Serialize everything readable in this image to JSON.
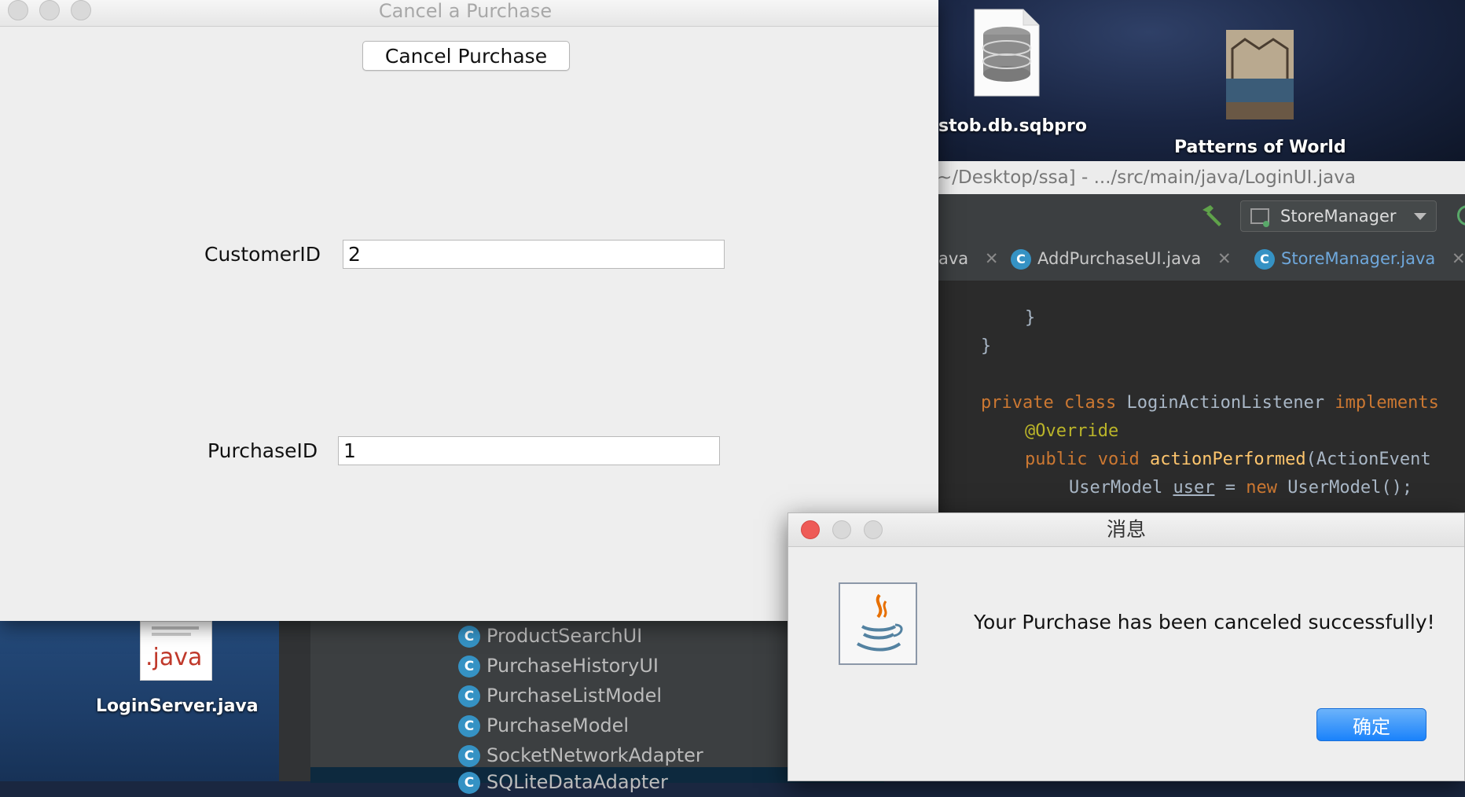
{
  "desktop": {
    "icons": [
      {
        "label": "stob.db.sqbpro",
        "kind": "database-file"
      },
      {
        "label": "Patterns of World",
        "kind": "book-cover"
      },
      {
        "label": "LoginServer.java",
        "kind": "java-file",
        "badge": ".java"
      }
    ]
  },
  "ide": {
    "title": "~/Desktop/ssa] - .../src/main/java/LoginUI.java",
    "run_config": "StoreManager",
    "tabs": [
      {
        "label": "ava"
      },
      {
        "label": "AddPurchaseUI.java"
      },
      {
        "label": "StoreManager.java"
      }
    ],
    "code": {
      "line1": "}",
      "line2": "}",
      "l3_kw1": "private",
      "l3_kw2": "class",
      "l3_name": "LoginActionListener",
      "l3_kw3": "implements",
      "l4_ann": "@Override",
      "l5_kw1": "public",
      "l5_kw2": "void",
      "l5_fn": "actionPerformed",
      "l5_rest": "(ActionEvent",
      "l6_type": "UserModel",
      "l6_var": "user",
      "l6_eq": " = ",
      "l6_new": "new",
      "l6_rest": " UserModel();"
    }
  },
  "project_tree": {
    "items": [
      "ProductSearchUI",
      "PurchaseHistoryUI",
      "PurchaseListModel",
      "PurchaseModel",
      "SocketNetworkAdapter",
      "SQLiteDataAdapter"
    ]
  },
  "cancel_window": {
    "title": "Cancel a Purchase",
    "button_label": "Cancel Purchase",
    "customer_label": "CustomerID",
    "customer_value": "2",
    "purchase_label": "PurchaseID",
    "purchase_value": "1"
  },
  "message_dialog": {
    "title": "消息",
    "message": "Your Purchase has been canceled successfully!",
    "ok_label": "确定"
  },
  "colors": {
    "close_red": "#ee5b57",
    "ok_blue": "#1a82fb",
    "class_icon": "#3592c4",
    "keyword": "#cc7832",
    "annotation": "#bbb529",
    "method": "#ffc66d"
  }
}
